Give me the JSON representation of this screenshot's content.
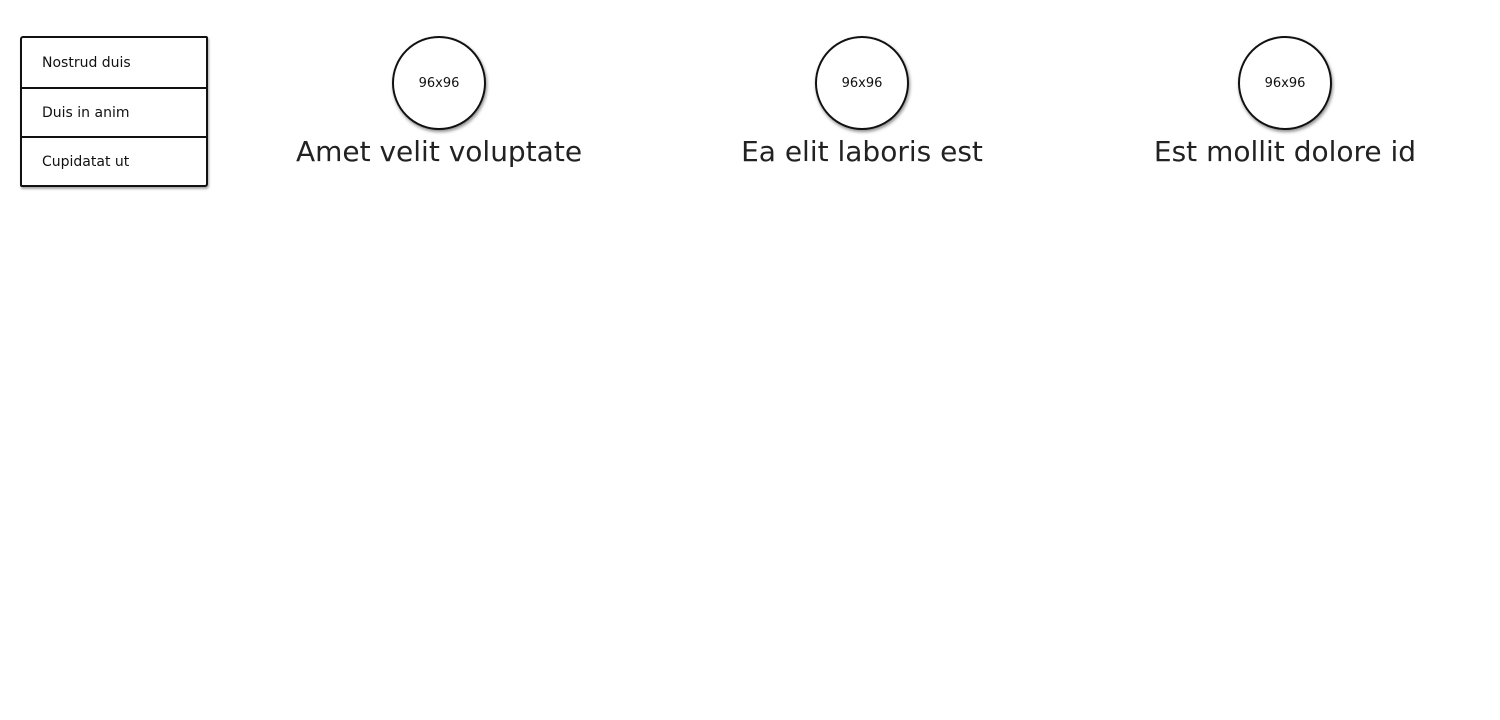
{
  "menu": {
    "items": [
      {
        "label": "Nostrud duis"
      },
      {
        "label": "Duis in anim"
      },
      {
        "label": "Cupidatat ut"
      }
    ]
  },
  "features": [
    {
      "image_label": "96x96",
      "title": "Amet velit voluptate"
    },
    {
      "image_label": "96x96",
      "title": "Ea elit laboris est"
    },
    {
      "image_label": "96x96",
      "title": "Est mollit dolore id"
    }
  ]
}
